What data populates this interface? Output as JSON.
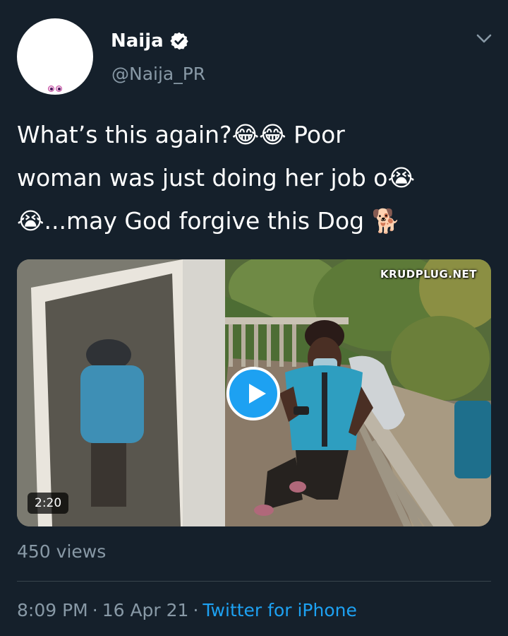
{
  "tweet": {
    "author": {
      "display_name": "Naija",
      "handle": "@Naija_PR",
      "verified": true
    },
    "text": "What’s this again?😂😂 Poor\nwoman was just doing her job o😭\n😭...may God forgive this Dog 🐕",
    "media": {
      "watermark": "KRUDPLUG.NET",
      "duration": "2:20"
    },
    "views": "450 views",
    "time": "8:09 PM",
    "date": "16 Apr 21",
    "separator": "·",
    "source": "Twitter for iPhone"
  },
  "icons": {
    "verified": "verified-badge-icon",
    "menu": "chevron-down-icon",
    "play": "play-icon"
  },
  "colors": {
    "background": "#15202b",
    "text": "#ffffff",
    "secondary_text": "#8899a6",
    "accent": "#1da1f2"
  }
}
